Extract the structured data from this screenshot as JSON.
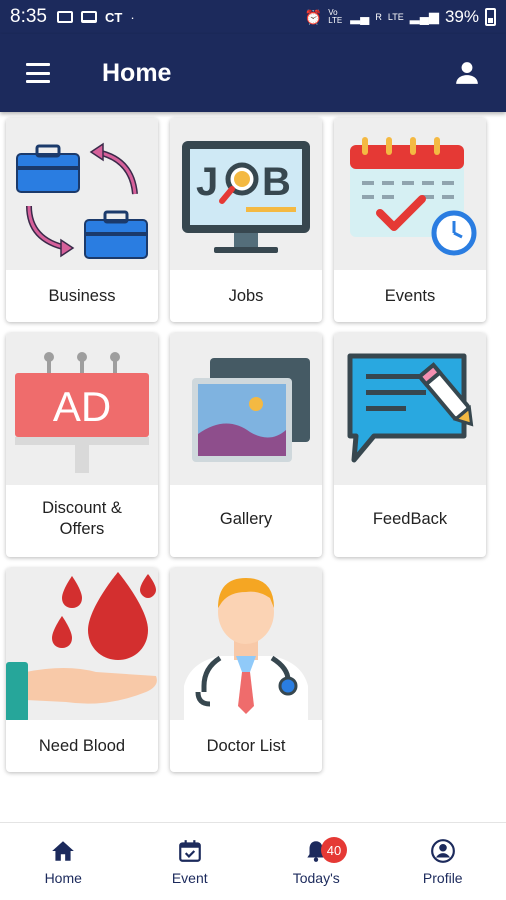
{
  "status_bar": {
    "time": "8:35",
    "carrier": "CT",
    "net_label_1": "Vo LTE",
    "net_label_2": "R",
    "net_label_3": "LTE",
    "battery": "39%"
  },
  "app_bar": {
    "title": "Home"
  },
  "tiles": [
    {
      "label": "Business",
      "icon": "business-icon"
    },
    {
      "label": "Jobs",
      "icon": "job-monitor-icon"
    },
    {
      "label": "Events",
      "icon": "calendar-icon"
    },
    {
      "label": "Discount & Offers",
      "icon": "ad-billboard-icon"
    },
    {
      "label": "Gallery",
      "icon": "gallery-icon"
    },
    {
      "label": "FeedBack",
      "icon": "feedback-icon"
    },
    {
      "label": "Need Blood",
      "icon": "blood-drop-icon"
    },
    {
      "label": "Doctor List",
      "icon": "doctor-icon"
    }
  ],
  "bottom_nav": {
    "items": [
      {
        "label": "Home",
        "icon": "home-icon"
      },
      {
        "label": "Event",
        "icon": "calendar-check-icon"
      },
      {
        "label": "Today's",
        "icon": "bell-icon",
        "badge": "40"
      },
      {
        "label": "Profile",
        "icon": "account-circle-icon"
      }
    ]
  },
  "colors": {
    "primary": "#1c2a5c",
    "tile_bg": "#eeeeee",
    "badge": "#e53935"
  }
}
